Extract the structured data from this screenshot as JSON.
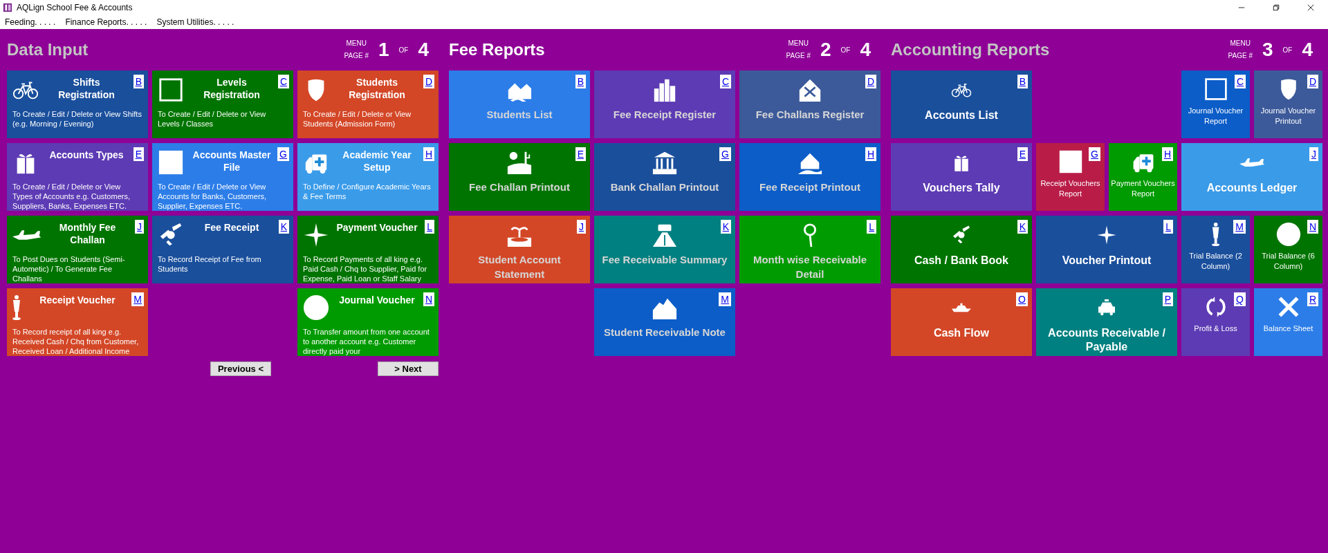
{
  "window": {
    "title": "AQLign School Fee & Accounts"
  },
  "menu": [
    "Feeding. . . . .",
    "Finance Reports. . . . .",
    "System Utilities. . . . ."
  ],
  "panels": [
    {
      "title": "Data Input",
      "muted": true,
      "menu_label": "MENU",
      "page_label": "PAGE #",
      "page": "1",
      "of": "OF",
      "total": "4",
      "tiles": [
        {
          "kind": "detail",
          "title": "Shifts Registration",
          "key": "B",
          "description": "To Create / Edit / Delete or View Shifts (e.g. Morning / Evening)",
          "color": "#1a4f9c"
        },
        {
          "kind": "detail",
          "title": "Levels Registration",
          "key": "C",
          "description": "To Create / Edit / Delete or View Levels / Classes",
          "color": "#007400"
        },
        {
          "kind": "detail",
          "title": "Students Registration",
          "key": "D",
          "description": "To Create / Edit / Delete or View Students (Admission Form)",
          "color": "#d34727"
        },
        {
          "kind": "detail",
          "title": "Accounts Types",
          "key": "E",
          "description": "To Create / Edit / Delete or View Types of Accounts e.g. Customers, Suppliers, Banks, Expenses ETC.",
          "color": "#5d3bb4"
        },
        {
          "kind": "detail",
          "title": "Accounts Master File",
          "key": "G",
          "description": "To Create / Edit / Delete or View Accounts for Banks, Customers, Supplier, Expenses ETC.",
          "color": "#2c7de8"
        },
        {
          "kind": "detail",
          "title": "Academic Year Setup",
          "key": "H",
          "description": "To Define / Configure Academic Years & Fee Terms",
          "color": "#3a9be9"
        },
        {
          "kind": "detail",
          "title": "Monthly Fee Challan",
          "key": "J",
          "description": "To Post Dues on Students (Semi-Autometic) / To Generate Fee Challans",
          "color": "#007400"
        },
        {
          "kind": "detail",
          "title": "Fee Receipt",
          "key": "K",
          "description": "To Record Receipt of Fee from Students",
          "color": "#1a4f9c"
        },
        {
          "kind": "detail",
          "title": "Payment Voucher",
          "key": "L",
          "description": "To Record Payments of all king e.g. Paid Cash / Chq to Supplier, Paid for Expense, Paid Loan or Staff Salary",
          "color": "#007400"
        },
        {
          "kind": "detail",
          "title": "Receipt Voucher",
          "key": "M",
          "description": "To Record receipt of all king e.g. Received Cash / Chq from Customer, Received Loan / Additional Income",
          "color": "#d34727"
        },
        {
          "kind": "detail",
          "title": "Journal Voucher",
          "key": "N",
          "description": "To Transfer amount from one account to another account e.g. Customer directly paid your",
          "color": "#009b00"
        }
      ],
      "buttons": [
        "Previous <",
        "> Next"
      ]
    },
    {
      "title": "Fee Reports",
      "muted": false,
      "menu_label": "MENU",
      "page_label": "PAGE #",
      "page": "2",
      "of": "OF",
      "total": "4",
      "tiles": [
        {
          "kind": "report",
          "title": "Students List",
          "key": "B",
          "color": "#2c7de8"
        },
        {
          "kind": "report",
          "title": "Fee Receipt Register",
          "key": "C",
          "color": "#5d3bb4"
        },
        {
          "kind": "report",
          "title": "Fee Challans Register",
          "key": "D",
          "color": "#3c5a9a"
        },
        {
          "kind": "report",
          "title": "Fee Challan Printout",
          "key": "E",
          "color": "#007400"
        },
        {
          "kind": "report",
          "title": "Bank Challan Printout",
          "key": "G",
          "color": "#1a4f9c"
        },
        {
          "kind": "report",
          "title": "Fee Receipt Printout",
          "key": "H",
          "color": "#0c5dc8"
        },
        {
          "kind": "report",
          "title": "Student Account Statement",
          "key": "J",
          "color": "#d34727"
        },
        {
          "kind": "report",
          "title": "Fee Receivable Summary",
          "key": "K",
          "color": "#008080"
        },
        {
          "kind": "report",
          "title": "Month wise Receivable Detail",
          "key": "L",
          "color": "#009b00"
        },
        {
          "kind": "report",
          "title": "Student Receivable Note",
          "key": "M",
          "color": "#0c5dc8"
        }
      ]
    },
    {
      "title": "Accounting Reports",
      "muted": true,
      "menu_label": "MENU",
      "page_label": "PAGE #",
      "page": "3",
      "of": "OF",
      "total": "4",
      "tiles": [
        {
          "kind": "large",
          "title": "Accounts List",
          "key": "B",
          "color": "#1a4f9c"
        },
        {
          "kind": "small",
          "title": "Journal Voucher Report",
          "key": "C",
          "color": "#0c5dc8"
        },
        {
          "kind": "small",
          "title": "Journal Voucher Printout",
          "key": "D",
          "color": "#3c5a9a"
        },
        {
          "kind": "large",
          "title": "Vouchers Tally",
          "key": "E",
          "color": "#5d3bb4"
        },
        {
          "kind": "small",
          "title": "Receipt Vouchers Report",
          "key": "G",
          "color": "#b91d47"
        },
        {
          "kind": "small",
          "title": "Payment Vouchers Report",
          "key": "H",
          "color": "#009b00"
        },
        {
          "kind": "large",
          "title": "Accounts Ledger",
          "key": "J",
          "color": "#3a9be9"
        },
        {
          "kind": "large",
          "title": "Cash / Bank Book",
          "key": "K",
          "color": "#007400"
        },
        {
          "kind": "large",
          "title": "Voucher Printout",
          "key": "L",
          "color": "#1a4f9c"
        },
        {
          "kind": "small",
          "title": "Trial Balance (2 Column)",
          "key": "M",
          "color": "#1a4f9c"
        },
        {
          "kind": "small",
          "title": "Trial Balance (6 Column)",
          "key": "N",
          "color": "#007400"
        },
        {
          "kind": "large",
          "title": "Cash Flow",
          "key": "O",
          "color": "#d34727"
        },
        {
          "kind": "large",
          "title": "Accounts Receivable / Payable",
          "key": "P",
          "color": "#008080"
        },
        {
          "kind": "small",
          "title": "Profit & Loss",
          "key": "Q",
          "color": "#5d3bb4"
        },
        {
          "kind": "small",
          "title": "Balance Sheet",
          "key": "R",
          "color": "#2c7de8"
        }
      ]
    }
  ]
}
